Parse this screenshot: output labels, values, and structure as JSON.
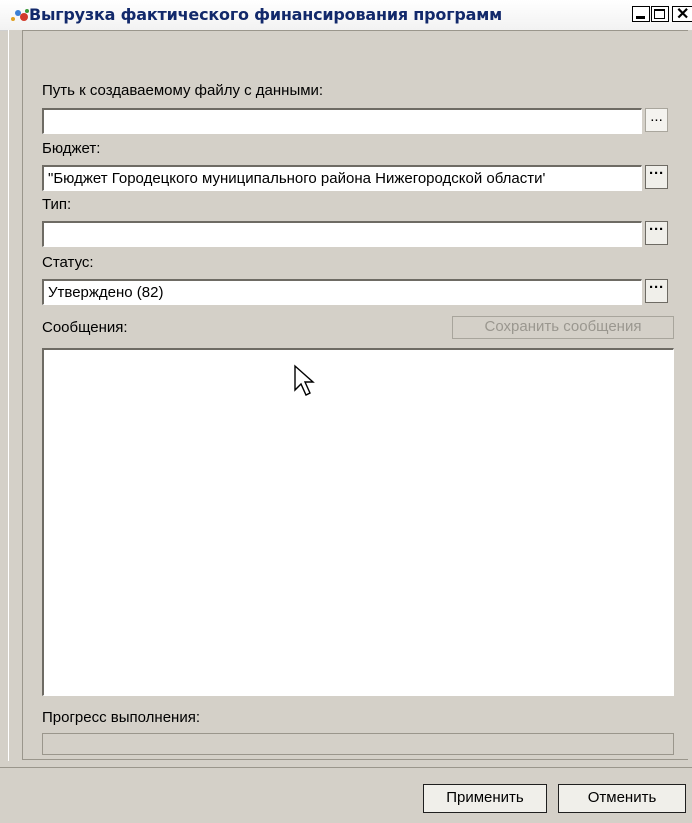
{
  "window": {
    "title": "Выгрузка фактического финансирования программ"
  },
  "fields": {
    "file_path": {
      "label": "Путь к создаваемому файлу с данными:",
      "value": "",
      "browse": "..."
    },
    "budget": {
      "label": "Бюджет:",
      "value": "\"Бюджет Городецкого муниципального района Нижегородской области'",
      "browse": "···"
    },
    "type": {
      "label": "Тип:",
      "value": "",
      "browse": "···"
    },
    "status": {
      "label": "Статус:",
      "value": "Утверждено (82)",
      "browse": "···"
    }
  },
  "messages": {
    "label": "Сообщения:",
    "save_label": "Сохранить сообщения"
  },
  "progress": {
    "label": "Прогресс выполнения:",
    "value": 0
  },
  "buttons": {
    "apply": "Применить",
    "cancel": "Отменить"
  },
  "icons": {
    "app": "app-icon",
    "cursor": "mouse-pointer-icon"
  },
  "colors": {
    "title_text": "#12296b",
    "window_bg": "#d4d0c8",
    "disabled_text": "#9a978f"
  }
}
